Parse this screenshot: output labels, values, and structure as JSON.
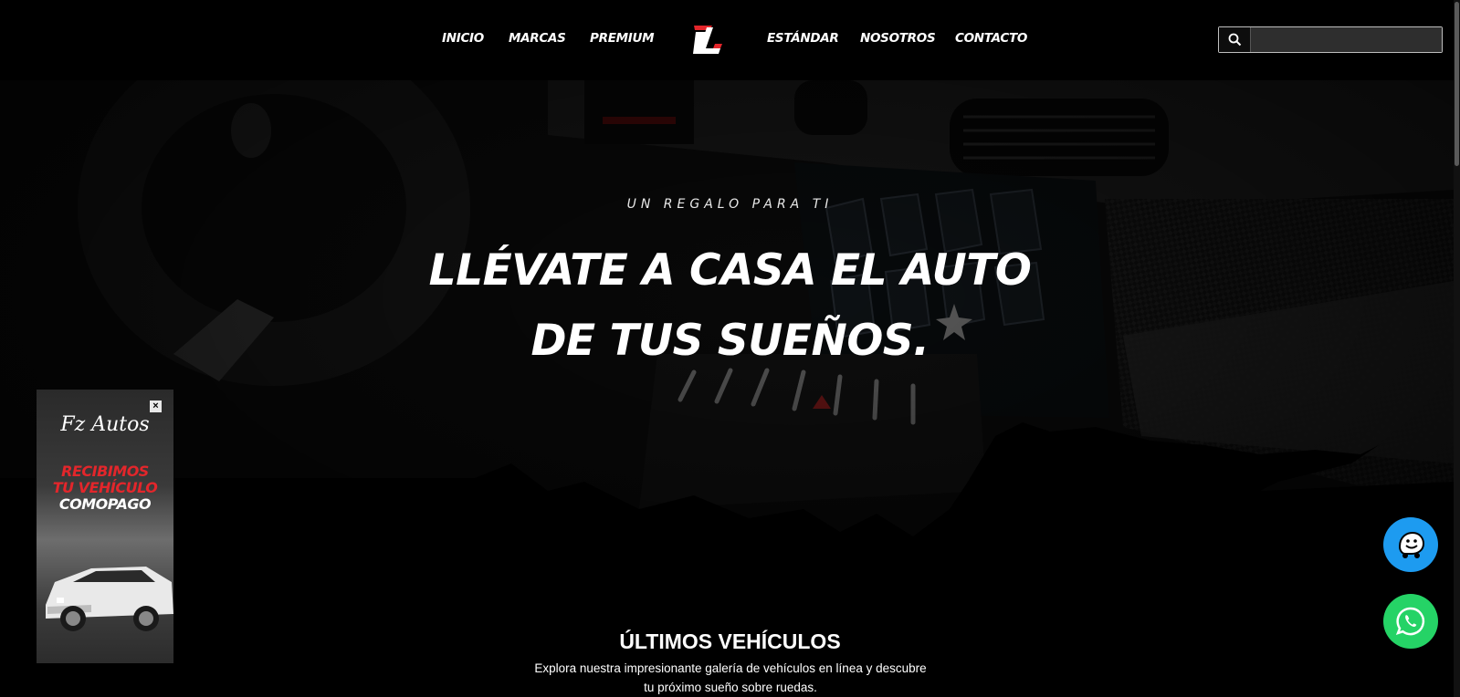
{
  "nav": {
    "left": [
      "INICIO",
      "MARCAS",
      "PREMIUM"
    ],
    "right": [
      "ESTÁNDAR",
      "NOSOTROS",
      "CONTACTO"
    ],
    "logo_icon": "zl-logo-icon"
  },
  "search": {
    "value": "",
    "placeholder": "",
    "icon": "search-icon"
  },
  "hero": {
    "eyebrow": "UN REGALO PARA TI",
    "title_line1": "LLÉVATE A CASA EL AUTO",
    "title_line2": "DE TUS SUEÑOS."
  },
  "latest": {
    "title": "ÚLTIMOS VEHÍCULOS",
    "description_line1": "Explora nuestra impresionante galería de vehículos en línea y descubre",
    "description_line2": "tu próximo sueño sobre ruedas."
  },
  "promo": {
    "brand": "Fz Autos",
    "line1": "RECIBIMOS",
    "line2": "TU VEHÍCULO",
    "line3": "COMOPAGO",
    "close_label": "×"
  },
  "floating": {
    "waze_icon": "waze-icon",
    "whatsapp_icon": "whatsapp-icon"
  },
  "colors": {
    "background": "#000000",
    "promo_red": "#e3262b",
    "waze_blue": "#1d9bf0",
    "whatsapp_green": "#25d366",
    "logo_red": "#e3262b"
  }
}
